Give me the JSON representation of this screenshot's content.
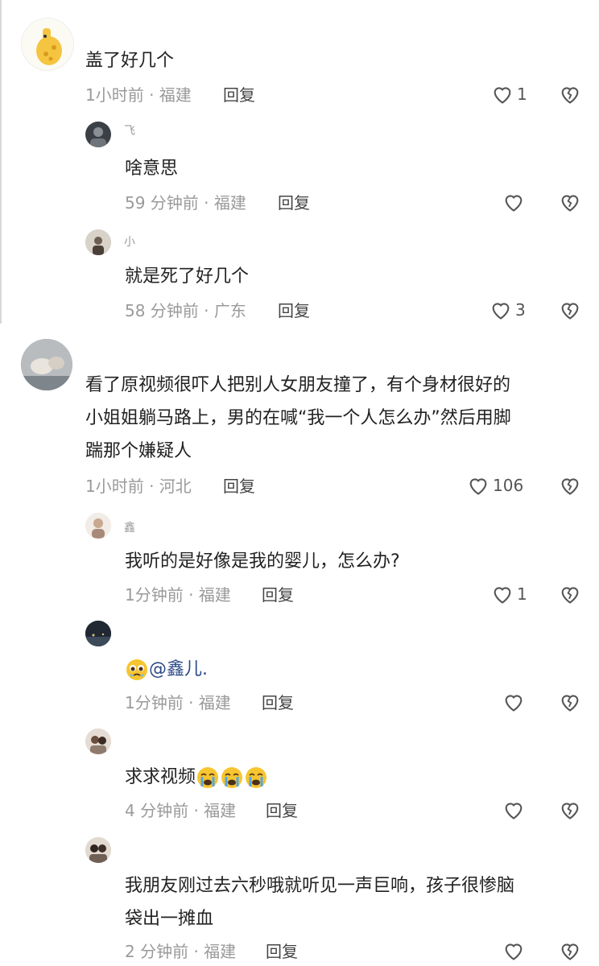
{
  "comments": [
    {
      "text": "盖了好几个",
      "meta": "1小时前 · 福建",
      "reply": "回复",
      "likes": "1",
      "replies": [
        {
          "name": "飞",
          "text": "啥意思",
          "meta": "59 分钟前 · 福建",
          "reply": "回复",
          "likes": ""
        },
        {
          "name": "小",
          "text": "就是死了好几个",
          "meta": "58 分钟前 · 广东",
          "reply": "回复",
          "likes": "3"
        }
      ]
    },
    {
      "lines": [
        "看了原视频很吓人把别人女朋友撞了，有个身材很好的",
        "小姐姐躺马路上，男的在喊“我一个人怎么办”然后用脚",
        "踹那个嫌疑人"
      ],
      "meta": "1小时前 · 河北",
      "reply": "回复",
      "likes": "106",
      "replies": [
        {
          "name": "鑫",
          "text": "我听的是好像是我的婴儿，怎么办?",
          "meta": "1分钟前 · 福建",
          "reply": "回复",
          "likes": "1"
        },
        {
          "mention": "@鑫儿.",
          "meta": "1分钟前 · 福建",
          "reply": "回复",
          "likes": ""
        },
        {
          "text": "求求视频",
          "meta": "4 分钟前 · 福建",
          "reply": "回复",
          "likes": ""
        },
        {
          "lines": [
            "我朋友刚过去六秒哦就听见一声巨响，孩子很惨脑",
            "袋出一摊血"
          ],
          "meta": "2 分钟前 · 福建",
          "reply": "回复",
          "likes": ""
        }
      ]
    }
  ],
  "icons": {
    "like": "heart-outline-icon",
    "dislike": "broken-heart-icon",
    "emoji_plead": "pleading-face-emoji",
    "emoji_cry": "loudly-crying-face-emoji"
  }
}
